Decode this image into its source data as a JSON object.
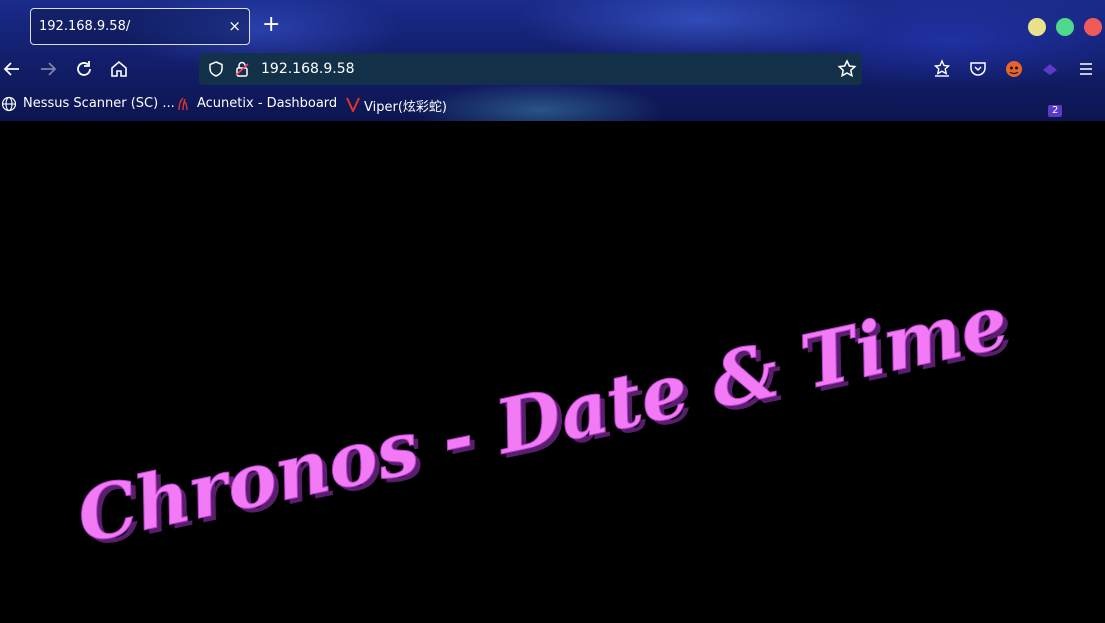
{
  "browser": {
    "tab": {
      "title": "192.168.9.58/",
      "close_glyph": "×"
    },
    "new_tab_glyph": "+",
    "window_controls": [
      {
        "name": "minimize-button",
        "color": "#e9e28a"
      },
      {
        "name": "maximize-button",
        "color": "#4cd98a"
      },
      {
        "name": "close-window-button",
        "color": "#f05a5a"
      }
    ],
    "toolbar": {
      "back_icon": "arrow-left-icon",
      "forward_icon": "arrow-right-icon",
      "reload_icon": "reload-icon",
      "home_icon": "home-icon",
      "url": "192.168.9.58",
      "extensions_badge": "2"
    },
    "bookmarks": [
      {
        "label": "Nessus Scanner (SC) ...",
        "icon": "globe-icon"
      },
      {
        "label": "Acunetix - Dashboard",
        "icon": "acunetix-icon"
      },
      {
        "label": "Viper(炫彩蛇)",
        "icon": "viper-v-icon"
      }
    ]
  },
  "page": {
    "hero_text": "Chronos - Date & Time",
    "hero_color": "#f27bf5",
    "hero_shadow_color": "#5a1e6e"
  }
}
